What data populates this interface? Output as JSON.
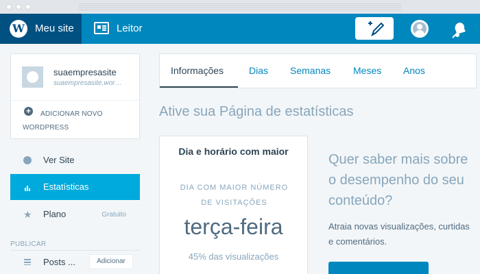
{
  "colors": {
    "topbar": "#0087be",
    "mysite_active": "#005082",
    "sidebar_active": "#00aadc",
    "text_dark": "#2e4453",
    "text_muted": "#87a6bc"
  },
  "topbar": {
    "logo_icon": "wordpress-logo",
    "mysite_label": "Meu site",
    "reader_icon": "reader-icon",
    "reader_label": "Leitor",
    "write_icon": "write-post-icon",
    "avatar_icon": "user-avatar",
    "notifications_icon": "notifications-bell-icon"
  },
  "sidebar": {
    "site": {
      "name": "suaempresasite",
      "url": "suaempresasite.wordpress.com",
      "add_new": "Adicionar novo WordPress"
    },
    "items": [
      {
        "label": "Ver Site",
        "icon": "globe-icon",
        "meta": ""
      },
      {
        "label": "Estatísticas",
        "icon": "stats-icon",
        "meta": ""
      },
      {
        "label": "Plano",
        "icon": "star-icon",
        "meta": "Gratuito"
      }
    ],
    "section_label": "Publicar",
    "posts_label": "Posts ...",
    "posts_add": "Adicionar"
  },
  "main": {
    "tabs": [
      {
        "label": "Informações",
        "selected": true
      },
      {
        "label": "Dias",
        "selected": false
      },
      {
        "label": "Semanas",
        "selected": false
      },
      {
        "label": "Meses",
        "selected": false
      },
      {
        "label": "Anos",
        "selected": false
      }
    ],
    "heading": "Ative sua Página de estatísticas",
    "stat_card": {
      "title": "Dia e horário com maior",
      "label": "Dia com maior número de visitações",
      "value": "terça-feira",
      "sub": "45% das visualizações"
    },
    "promo": {
      "title": "Quer saber mais sobre o desempenho do seu conteúdo?",
      "text": "Atraia novas visualizações, curtidas e comentários."
    }
  }
}
